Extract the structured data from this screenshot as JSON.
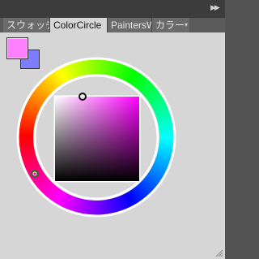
{
  "panel": {
    "collapse_icon": "double-chevron-right",
    "menu_icon": "panel-menu-icon",
    "tabs": [
      {
        "label": "スウォッチ",
        "active": false
      },
      {
        "label": "ColorCircle",
        "active": true
      },
      {
        "label": "PaintersW",
        "active": false
      },
      {
        "label": "カラー",
        "active": false
      }
    ]
  },
  "colors": {
    "foreground": "#ff80ff",
    "background": "#7d7dff",
    "hue_handle": "hue-ring-handle",
    "sv_handle": "saturation-value-handle"
  }
}
